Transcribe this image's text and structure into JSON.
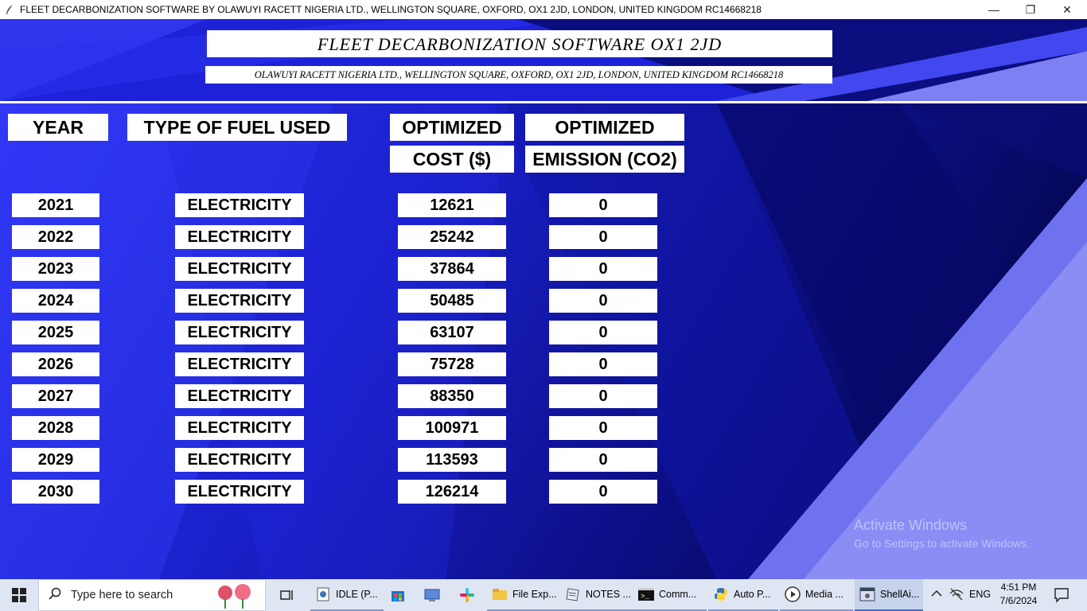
{
  "window": {
    "title": "FLEET DECARBONIZATION SOFTWARE BY OLAWUYI RACETT NIGERIA LTD., WELLINGTON SQUARE, OXFORD, OX1 2JD, LONDON, UNITED KINGDOM RC14668218",
    "minimize_glyph": "—",
    "maximize_glyph": "❐",
    "close_glyph": "✕"
  },
  "header": {
    "main_title": "FLEET DECARBONIZATION SOFTWARE OX1 2JD",
    "subtitle": "OLAWUYI RACETT NIGERIA LTD., WELLINGTON SQUARE, OXFORD, OX1 2JD, LONDON, UNITED KINGDOM RC14668218"
  },
  "columns": {
    "year": "YEAR",
    "fuel": "TYPE OF FUEL USED",
    "cost_line1": "OPTIMIZED",
    "cost_line2": "COST ($)",
    "emission_line1": "OPTIMIZED",
    "emission_line2": "EMISSION (CO2)"
  },
  "rows": [
    {
      "year": "2021",
      "fuel": "ELECTRICITY",
      "cost": "12621",
      "emission": "0"
    },
    {
      "year": "2022",
      "fuel": "ELECTRICITY",
      "cost": "25242",
      "emission": "0"
    },
    {
      "year": "2023",
      "fuel": "ELECTRICITY",
      "cost": "37864",
      "emission": "0"
    },
    {
      "year": "2024",
      "fuel": "ELECTRICITY",
      "cost": "50485",
      "emission": "0"
    },
    {
      "year": "2025",
      "fuel": "ELECTRICITY",
      "cost": "63107",
      "emission": "0"
    },
    {
      "year": "2026",
      "fuel": "ELECTRICITY",
      "cost": "75728",
      "emission": "0"
    },
    {
      "year": "2027",
      "fuel": "ELECTRICITY",
      "cost": "88350",
      "emission": "0"
    },
    {
      "year": "2028",
      "fuel": "ELECTRICITY",
      "cost": "100971",
      "emission": "0"
    },
    {
      "year": "2029",
      "fuel": "ELECTRICITY",
      "cost": "113593",
      "emission": "0"
    },
    {
      "year": "2030",
      "fuel": "ELECTRICITY",
      "cost": "126214",
      "emission": "0"
    }
  ],
  "watermark": {
    "title": "Activate Windows",
    "subtitle": "Go to Settings to activate Windows."
  },
  "taskbar": {
    "search_placeholder": "Type here to search",
    "apps": [
      {
        "label": "IDLE (P...",
        "icon": "python-file-icon"
      },
      {
        "label": "File Exp...",
        "icon": "folder-icon"
      },
      {
        "label": "NOTES ...",
        "icon": "notes-icon"
      },
      {
        "label": "Comm...",
        "icon": "terminal-icon"
      },
      {
        "label": "Auto P...",
        "icon": "python-icon"
      },
      {
        "label": "Media ...",
        "icon": "media-player-icon"
      },
      {
        "label": "ShellAi...",
        "icon": "app-window-icon"
      }
    ],
    "language": "ENG",
    "time": "4:51 PM",
    "date": "7/6/2024"
  },
  "colors": {
    "background_dark": "#0a0d8a",
    "background_bright": "#2b33f5",
    "stripe_light": "#8a8cf2",
    "taskbar": "#dfe6f3"
  }
}
